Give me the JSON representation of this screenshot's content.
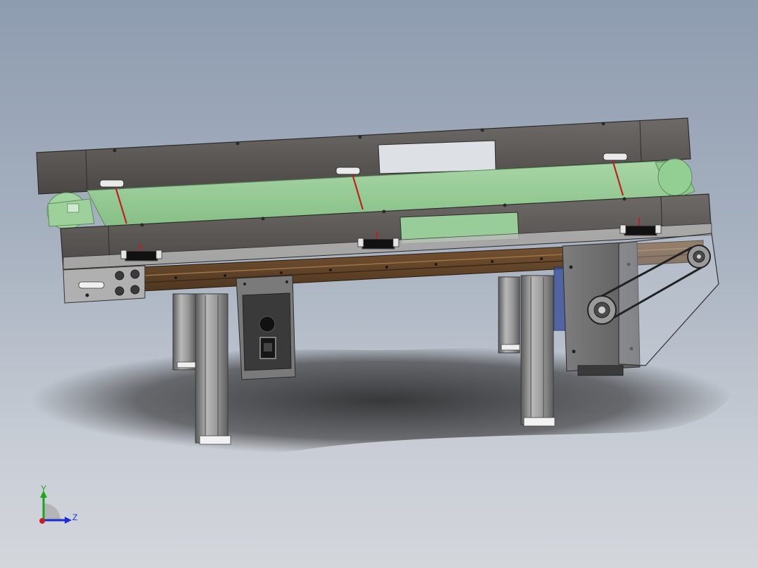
{
  "viewport": {
    "background_top": "#8e9cb0",
    "background_bottom": "#d3d6db"
  },
  "model": {
    "frame_color": "#5d5a58",
    "belt_color": "#98cc98",
    "rail_color": "#6b4a2b",
    "leg_color": "#8a8a8a",
    "strap_color": "#c0201f"
  },
  "triad": {
    "y_label": "Y",
    "z_label": "Z",
    "y_color": "#1aa51a",
    "z_color": "#1b2bd6",
    "x_color": "#c81e1e"
  }
}
